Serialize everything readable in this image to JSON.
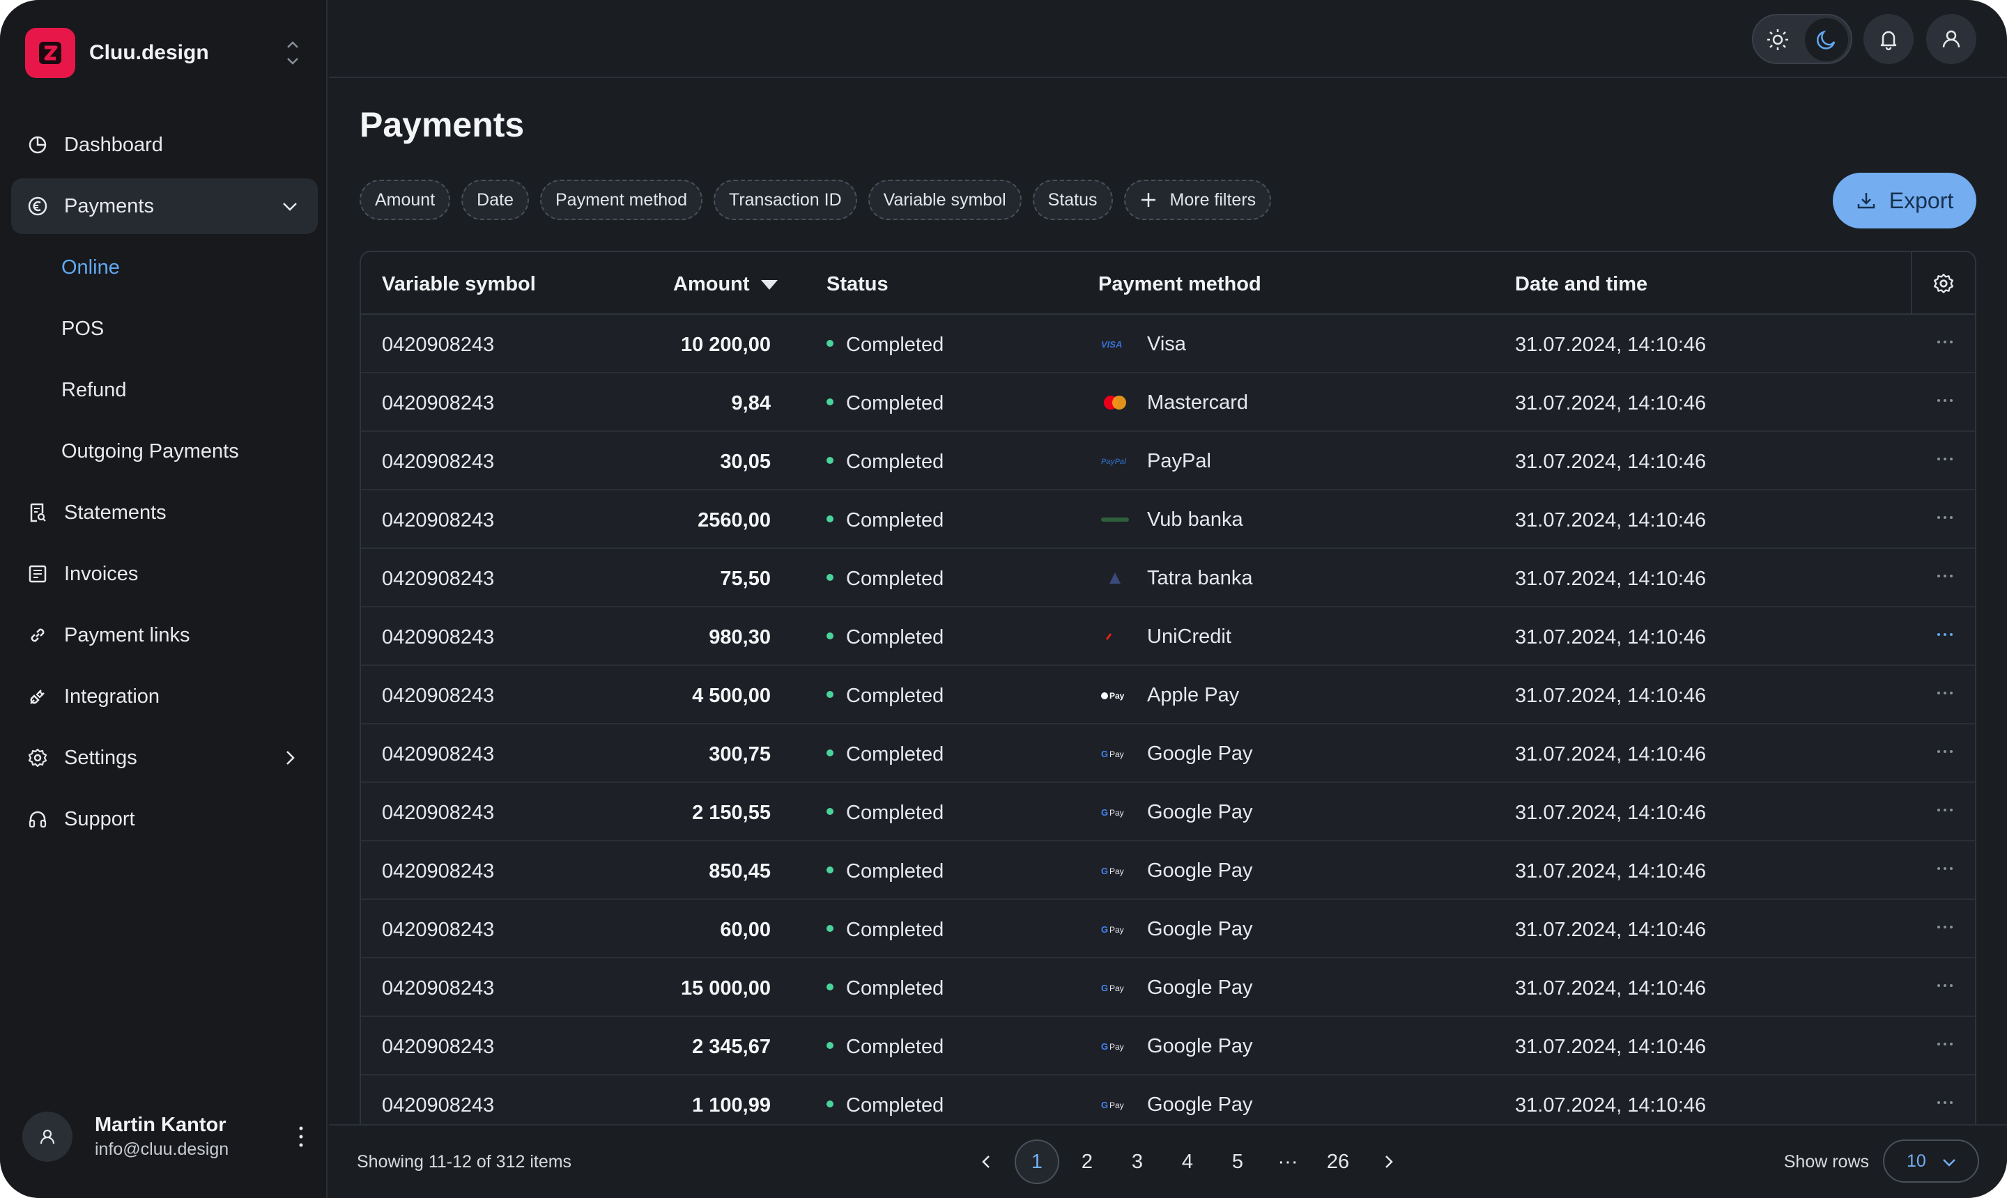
{
  "brand": {
    "name": "Cluu.design",
    "logo_letter": "Z",
    "accent": "#e8174a"
  },
  "sidebar": {
    "items": [
      {
        "label": "Dashboard",
        "icon": "pie-chart-icon"
      },
      {
        "label": "Payments",
        "icon": "euro-icon",
        "active": true,
        "expanded": true
      },
      {
        "label": "Statements",
        "icon": "receipt-search-icon"
      },
      {
        "label": "Invoices",
        "icon": "invoice-icon"
      },
      {
        "label": "Payment links",
        "icon": "link-icon"
      },
      {
        "label": "Integration",
        "icon": "plug-icon"
      },
      {
        "label": "Settings",
        "icon": "gear-icon"
      },
      {
        "label": "Support",
        "icon": "headphones-icon"
      }
    ],
    "payments_sub": [
      "Online",
      "POS",
      "Refund",
      "Outgoing Payments"
    ]
  },
  "user": {
    "name": "Martin Kantor",
    "email": "info@cluu.design"
  },
  "page": {
    "title": "Payments"
  },
  "filters": [
    "Amount",
    "Date",
    "Payment method",
    "Transaction ID",
    "Variable symbol",
    "Status"
  ],
  "more_filters_label": "More filters",
  "export_label": "Export",
  "table": {
    "headers": {
      "vs": "Variable symbol",
      "amount": "Amount",
      "status": "Status",
      "method": "Payment method",
      "date": "Date and time"
    },
    "rows": [
      {
        "vs": "0420908243",
        "amount": "10 200,00",
        "status": "Completed",
        "method": "Visa",
        "logo": "visa",
        "date": "31.07.2024, 14:10:46"
      },
      {
        "vs": "0420908243",
        "amount": "9,84",
        "status": "Completed",
        "method": "Mastercard",
        "logo": "mastercard",
        "date": "31.07.2024, 14:10:46"
      },
      {
        "vs": "0420908243",
        "amount": "30,05",
        "status": "Completed",
        "method": "PayPal",
        "logo": "paypal",
        "date": "31.07.2024, 14:10:46"
      },
      {
        "vs": "0420908243",
        "amount": "2560,00",
        "status": "Completed",
        "method": "Vub banka",
        "logo": "vub",
        "date": "31.07.2024, 14:10:46"
      },
      {
        "vs": "0420908243",
        "amount": "75,50",
        "status": "Completed",
        "method": "Tatra banka",
        "logo": "tatra",
        "date": "31.07.2024, 14:10:46"
      },
      {
        "vs": "0420908243",
        "amount": "980,30",
        "status": "Completed",
        "method": "UniCredit",
        "logo": "unicredit",
        "date": "31.07.2024, 14:10:46"
      },
      {
        "vs": "0420908243",
        "amount": "4 500,00",
        "status": "Completed",
        "method": "Apple Pay",
        "logo": "applepay",
        "date": "31.07.2024, 14:10:46"
      },
      {
        "vs": "0420908243",
        "amount": "300,75",
        "status": "Completed",
        "method": "Google Pay",
        "logo": "gpay",
        "date": "31.07.2024, 14:10:46"
      },
      {
        "vs": "0420908243",
        "amount": "2 150,55",
        "status": "Completed",
        "method": "Google Pay",
        "logo": "gpay",
        "date": "31.07.2024, 14:10:46"
      },
      {
        "vs": "0420908243",
        "amount": "850,45",
        "status": "Completed",
        "method": "Google Pay",
        "logo": "gpay",
        "date": "31.07.2024, 14:10:46"
      },
      {
        "vs": "0420908243",
        "amount": "60,00",
        "status": "Completed",
        "method": "Google Pay",
        "logo": "gpay",
        "date": "31.07.2024, 14:10:46"
      },
      {
        "vs": "0420908243",
        "amount": "15 000,00",
        "status": "Completed",
        "method": "Google Pay",
        "logo": "gpay",
        "date": "31.07.2024, 14:10:46"
      },
      {
        "vs": "0420908243",
        "amount": "2 345,67",
        "status": "Completed",
        "method": "Google Pay",
        "logo": "gpay",
        "date": "31.07.2024, 14:10:46"
      },
      {
        "vs": "0420908243",
        "amount": "1 100,99",
        "status": "Completed",
        "method": "Google Pay",
        "logo": "gpay",
        "date": "31.07.2024, 14:10:46"
      }
    ]
  },
  "pagination": {
    "showing": "Showing 11-12 of 312 items",
    "pages": [
      "1",
      "2",
      "3",
      "4",
      "5",
      "···",
      "26"
    ],
    "current": "1",
    "show_rows_label": "Show rows",
    "rows_value": "10"
  },
  "colors": {
    "status_completed": "#4ad39b",
    "link_blue": "#62a8f0",
    "export_bg": "#74aef0"
  }
}
